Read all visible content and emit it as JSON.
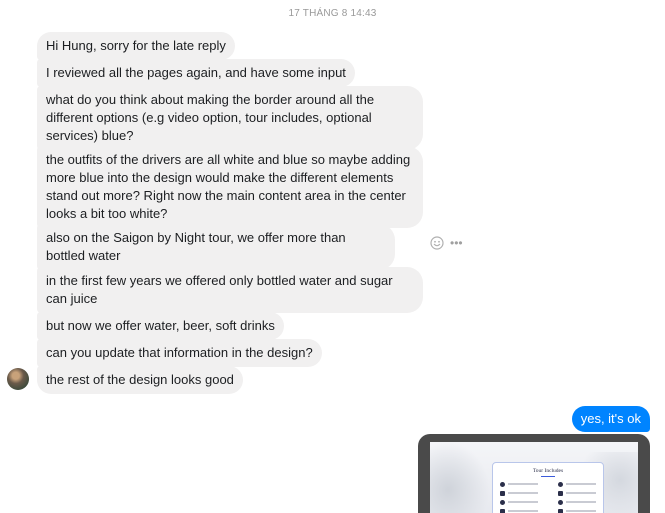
{
  "conversation": {
    "timestamp": "17 THÁNG 8 14:43",
    "incoming_messages": [
      "Hi Hung, sorry for the late reply",
      "I reviewed all the pages again, and have some input",
      "what do you think about making the border around all the different options (e.g video option, tour includes, optional services) blue?",
      "the outfits of the drivers are all white and blue so maybe adding more blue into the design would make the different elements stand out more? Right now the main content area in the center looks a bit too white?",
      "also on the Saigon by Night tour, we offer more than bottled water",
      "in the first few years we offered only bottled water and sugar can juice",
      "but now we offer water, beer, soft drinks",
      "can you update that information in the design?",
      "the rest of the design looks good"
    ],
    "outgoing_messages": [
      "yes, it's ok"
    ],
    "attachment": {
      "card_title": "Tour Includes"
    }
  },
  "icons": {
    "reaction": "smiley-face-icon",
    "more": "more-options-icon"
  },
  "colors": {
    "incoming_bubble": "#f1f0f0",
    "outgoing_bubble": "#0084ff",
    "timestamp": "#999999"
  }
}
